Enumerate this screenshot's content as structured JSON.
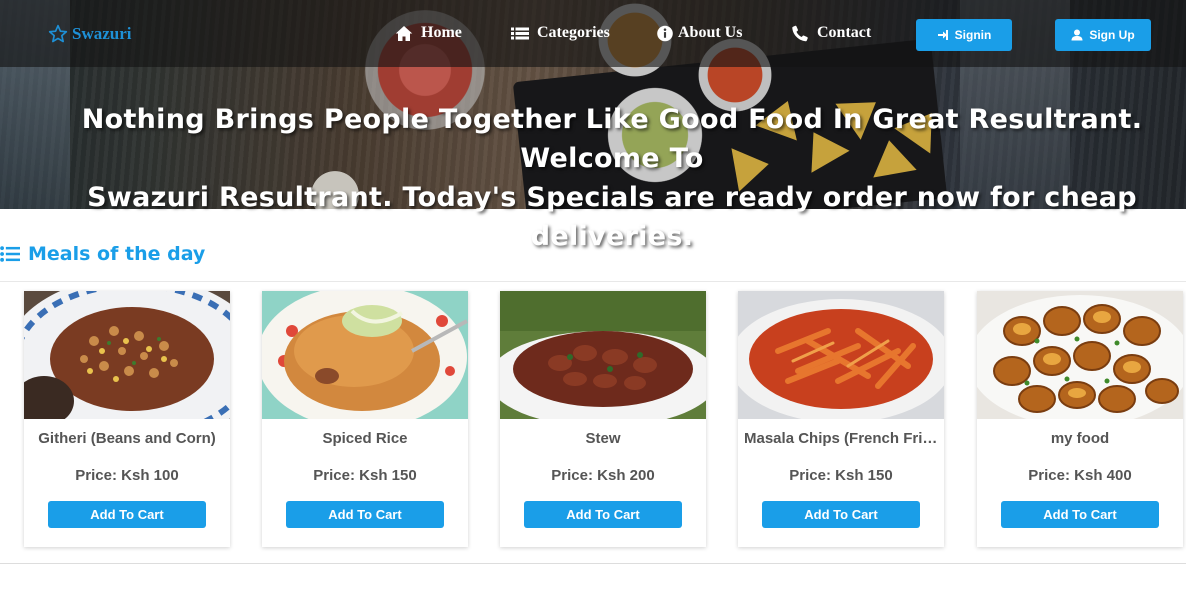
{
  "brand": {
    "name": "Swazuri",
    "icon": "star-outline-icon",
    "color": "#1e90d6"
  },
  "nav": {
    "links": [
      {
        "label": "Home",
        "icon": "home-icon"
      },
      {
        "label": "Categories",
        "icon": "list-icon"
      },
      {
        "label": "About Us",
        "icon": "info-circle-icon"
      },
      {
        "label": "Contact",
        "icon": "phone-icon"
      }
    ],
    "signin_label": "Signin",
    "signup_label": "Sign Up"
  },
  "hero": {
    "line1": "Nothing Brings People Together Like Good Food In Great Resultrant. Welcome To",
    "line2": "Swazuri Resultrant. Today's Specials are ready order now for cheap deliveries."
  },
  "section": {
    "title": "Meals of the day",
    "icon": "list-icon"
  },
  "accent_color": "#1a9ee8",
  "meals": [
    {
      "name": "Githeri (Beans and Corn)",
      "price": "Price: Ksh 100",
      "button": "Add To Cart"
    },
    {
      "name": "Spiced Rice",
      "price": "Price: Ksh 150",
      "button": "Add To Cart"
    },
    {
      "name": "Stew",
      "price": "Price: Ksh 200",
      "button": "Add To Cart"
    },
    {
      "name": "Masala Chips (French Fries)",
      "price": "Price: Ksh 150",
      "button": "Add To Cart"
    },
    {
      "name": "my food",
      "price": "Price: Ksh 400",
      "button": "Add To Cart"
    }
  ]
}
